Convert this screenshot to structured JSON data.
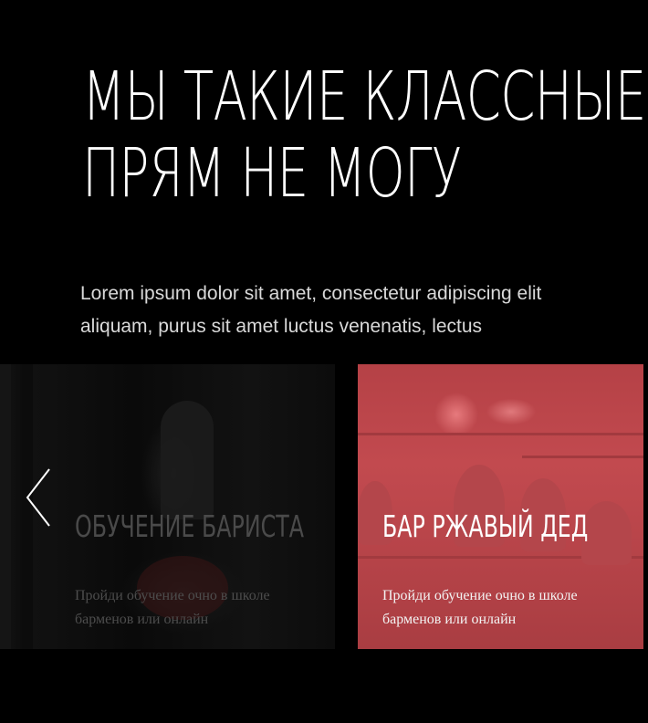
{
  "hero": {
    "title_line1": "МЫ ТАКИЕ КЛАССНЫЕ",
    "title_line2": "ПРЯМ НЕ МОГУ",
    "intro_line1": "Lorem ipsum dolor sit amet, consectetur adipiscing elit",
    "intro_line2": "aliquam, purus sit amet luctus venenatis, lectus"
  },
  "slider": {
    "prev_icon": "chevron-left-icon",
    "cards": [
      {
        "title": "ОБУЧЕНИЕ БАРИСТА",
        "text": "Пройди обучение очно в школе барменов или онлайн"
      },
      {
        "title": "БАР РЖАВЫЙ ДЕД",
        "text": "Пройди обучение очно в школе барменов или онлайн"
      }
    ]
  },
  "colors": {
    "background": "#000000",
    "accent": "#c24a4f",
    "text": "#ffffff"
  }
}
